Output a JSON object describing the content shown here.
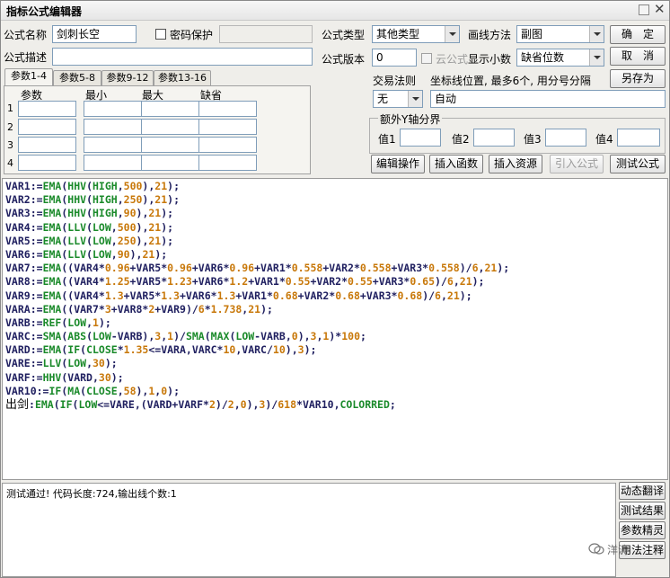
{
  "window": {
    "title": "指标公式编辑器"
  },
  "form": {
    "name_label": "公式名称",
    "name_value": "剑刺长空",
    "password_label": "密码保护",
    "desc_label": "公式描述",
    "type_label": "公式类型",
    "type_value": "其他类型",
    "draw_label": "画线方法",
    "draw_value": "副图",
    "version_label": "公式版本",
    "version_value": "0",
    "cloud_label": "云公式",
    "decimals_label": "显示小数",
    "decimals_value": "缺省位数",
    "trade_label": "交易法则",
    "trade_value": "无",
    "coord_label": "坐标线位置, 最多6个, 用分号分隔",
    "coord_value": "自动",
    "yaxis_label": "额外Y轴分界",
    "val1": "值1",
    "val2": "值2",
    "val3": "值3",
    "val4": "值4"
  },
  "buttons": {
    "ok": "确　定",
    "cancel": "取　消",
    "save_as": "另存为",
    "edit_ops": "编辑操作",
    "insert_fn": "插入函数",
    "insert_res": "插入资源",
    "import_formula": "引入公式",
    "test_formula": "测试公式"
  },
  "tabs": [
    "参数1-4",
    "参数5-8",
    "参数9-12",
    "参数13-16"
  ],
  "params": {
    "headers": [
      "参数",
      "最小",
      "最大",
      "缺省"
    ],
    "rows": [
      "1",
      "2",
      "3",
      "4"
    ]
  },
  "code": [
    [
      [
        "VAR1",
        "id"
      ],
      [
        ":=",
        "op"
      ],
      [
        "EMA",
        "fn"
      ],
      [
        "(",
        "op"
      ],
      [
        "HHV",
        "fn"
      ],
      [
        "(",
        "op"
      ],
      [
        "HIGH",
        "fn"
      ],
      [
        ",",
        "op"
      ],
      [
        "500",
        "num"
      ],
      [
        ")",
        "op"
      ],
      [
        ",",
        "op"
      ],
      [
        "21",
        "num"
      ],
      [
        ");",
        "op"
      ]
    ],
    [
      [
        "VAR2",
        "id"
      ],
      [
        ":=",
        "op"
      ],
      [
        "EMA",
        "fn"
      ],
      [
        "(",
        "op"
      ],
      [
        "HHV",
        "fn"
      ],
      [
        "(",
        "op"
      ],
      [
        "HIGH",
        "fn"
      ],
      [
        ",",
        "op"
      ],
      [
        "250",
        "num"
      ],
      [
        ")",
        "op"
      ],
      [
        ",",
        "op"
      ],
      [
        "21",
        "num"
      ],
      [
        ");",
        "op"
      ]
    ],
    [
      [
        "VAR3",
        "id"
      ],
      [
        ":=",
        "op"
      ],
      [
        "EMA",
        "fn"
      ],
      [
        "(",
        "op"
      ],
      [
        "HHV",
        "fn"
      ],
      [
        "(",
        "op"
      ],
      [
        "HIGH",
        "fn"
      ],
      [
        ",",
        "op"
      ],
      [
        "90",
        "num"
      ],
      [
        ")",
        "op"
      ],
      [
        ",",
        "op"
      ],
      [
        "21",
        "num"
      ],
      [
        ");",
        "op"
      ]
    ],
    [
      [
        "VAR4",
        "id"
      ],
      [
        ":=",
        "op"
      ],
      [
        "EMA",
        "fn"
      ],
      [
        "(",
        "op"
      ],
      [
        "LLV",
        "fn"
      ],
      [
        "(",
        "op"
      ],
      [
        "LOW",
        "fn"
      ],
      [
        ",",
        "op"
      ],
      [
        "500",
        "num"
      ],
      [
        ")",
        "op"
      ],
      [
        ",",
        "op"
      ],
      [
        "21",
        "num"
      ],
      [
        ");",
        "op"
      ]
    ],
    [
      [
        "VAR5",
        "id"
      ],
      [
        ":=",
        "op"
      ],
      [
        "EMA",
        "fn"
      ],
      [
        "(",
        "op"
      ],
      [
        "LLV",
        "fn"
      ],
      [
        "(",
        "op"
      ],
      [
        "LOW",
        "fn"
      ],
      [
        ",",
        "op"
      ],
      [
        "250",
        "num"
      ],
      [
        ")",
        "op"
      ],
      [
        ",",
        "op"
      ],
      [
        "21",
        "num"
      ],
      [
        ");",
        "op"
      ]
    ],
    [
      [
        "VAR6",
        "id"
      ],
      [
        ":=",
        "op"
      ],
      [
        "EMA",
        "fn"
      ],
      [
        "(",
        "op"
      ],
      [
        "LLV",
        "fn"
      ],
      [
        "(",
        "op"
      ],
      [
        "LOW",
        "fn"
      ],
      [
        ",",
        "op"
      ],
      [
        "90",
        "num"
      ],
      [
        ")",
        "op"
      ],
      [
        ",",
        "op"
      ],
      [
        "21",
        "num"
      ],
      [
        ");",
        "op"
      ]
    ],
    [
      [
        "VAR7",
        "id"
      ],
      [
        ":=",
        "op"
      ],
      [
        "EMA",
        "fn"
      ],
      [
        "((",
        "op"
      ],
      [
        "VAR4",
        "id"
      ],
      [
        "*",
        "op"
      ],
      [
        "0.96",
        "num"
      ],
      [
        "+",
        "op"
      ],
      [
        "VAR5",
        "id"
      ],
      [
        "*",
        "op"
      ],
      [
        "0.96",
        "num"
      ],
      [
        "+",
        "op"
      ],
      [
        "VAR6",
        "id"
      ],
      [
        "*",
        "op"
      ],
      [
        "0.96",
        "num"
      ],
      [
        "+",
        "op"
      ],
      [
        "VAR1",
        "id"
      ],
      [
        "*",
        "op"
      ],
      [
        "0.558",
        "num"
      ],
      [
        "+",
        "op"
      ],
      [
        "VAR2",
        "id"
      ],
      [
        "*",
        "op"
      ],
      [
        "0.558",
        "num"
      ],
      [
        "+",
        "op"
      ],
      [
        "VAR3",
        "id"
      ],
      [
        "*",
        "op"
      ],
      [
        "0.558",
        "num"
      ],
      [
        ")/",
        "op"
      ],
      [
        "6",
        "num"
      ],
      [
        ",",
        "op"
      ],
      [
        "21",
        "num"
      ],
      [
        ");",
        "op"
      ]
    ],
    [
      [
        "VAR8",
        "id"
      ],
      [
        ":=",
        "op"
      ],
      [
        "EMA",
        "fn"
      ],
      [
        "((",
        "op"
      ],
      [
        "VAR4",
        "id"
      ],
      [
        "*",
        "op"
      ],
      [
        "1.25",
        "num"
      ],
      [
        "+",
        "op"
      ],
      [
        "VAR5",
        "id"
      ],
      [
        "*",
        "op"
      ],
      [
        "1.23",
        "num"
      ],
      [
        "+",
        "op"
      ],
      [
        "VAR6",
        "id"
      ],
      [
        "*",
        "op"
      ],
      [
        "1.2",
        "num"
      ],
      [
        "+",
        "op"
      ],
      [
        "VAR1",
        "id"
      ],
      [
        "*",
        "op"
      ],
      [
        "0.55",
        "num"
      ],
      [
        "+",
        "op"
      ],
      [
        "VAR2",
        "id"
      ],
      [
        "*",
        "op"
      ],
      [
        "0.55",
        "num"
      ],
      [
        "+",
        "op"
      ],
      [
        "VAR3",
        "id"
      ],
      [
        "*",
        "op"
      ],
      [
        "0.65",
        "num"
      ],
      [
        ")/",
        "op"
      ],
      [
        "6",
        "num"
      ],
      [
        ",",
        "op"
      ],
      [
        "21",
        "num"
      ],
      [
        ");",
        "op"
      ]
    ],
    [
      [
        "VAR9",
        "id"
      ],
      [
        ":=",
        "op"
      ],
      [
        "EMA",
        "fn"
      ],
      [
        "((",
        "op"
      ],
      [
        "VAR4",
        "id"
      ],
      [
        "*",
        "op"
      ],
      [
        "1.3",
        "num"
      ],
      [
        "+",
        "op"
      ],
      [
        "VAR5",
        "id"
      ],
      [
        "*",
        "op"
      ],
      [
        "1.3",
        "num"
      ],
      [
        "+",
        "op"
      ],
      [
        "VAR6",
        "id"
      ],
      [
        "*",
        "op"
      ],
      [
        "1.3",
        "num"
      ],
      [
        "+",
        "op"
      ],
      [
        "VAR1",
        "id"
      ],
      [
        "*",
        "op"
      ],
      [
        "0.68",
        "num"
      ],
      [
        "+",
        "op"
      ],
      [
        "VAR2",
        "id"
      ],
      [
        "*",
        "op"
      ],
      [
        "0.68",
        "num"
      ],
      [
        "+",
        "op"
      ],
      [
        "VAR3",
        "id"
      ],
      [
        "*",
        "op"
      ],
      [
        "0.68",
        "num"
      ],
      [
        ")/",
        "op"
      ],
      [
        "6",
        "num"
      ],
      [
        ",",
        "op"
      ],
      [
        "21",
        "num"
      ],
      [
        ");",
        "op"
      ]
    ],
    [
      [
        "VARA",
        "id"
      ],
      [
        ":=",
        "op"
      ],
      [
        "EMA",
        "fn"
      ],
      [
        "((",
        "op"
      ],
      [
        "VAR7",
        "id"
      ],
      [
        "*",
        "op"
      ],
      [
        "3",
        "num"
      ],
      [
        "+",
        "op"
      ],
      [
        "VAR8",
        "id"
      ],
      [
        "*",
        "op"
      ],
      [
        "2",
        "num"
      ],
      [
        "+",
        "op"
      ],
      [
        "VAR9",
        "id"
      ],
      [
        ")/",
        "op"
      ],
      [
        "6",
        "num"
      ],
      [
        "*",
        "op"
      ],
      [
        "1.738",
        "num"
      ],
      [
        ",",
        "op"
      ],
      [
        "21",
        "num"
      ],
      [
        ");",
        "op"
      ]
    ],
    [
      [
        "VARB",
        "id"
      ],
      [
        ":=",
        "op"
      ],
      [
        "REF",
        "fn"
      ],
      [
        "(",
        "op"
      ],
      [
        "LOW",
        "fn"
      ],
      [
        ",",
        "op"
      ],
      [
        "1",
        "num"
      ],
      [
        ");",
        "op"
      ]
    ],
    [
      [
        "VARC",
        "id"
      ],
      [
        ":=",
        "op"
      ],
      [
        "SMA",
        "fn"
      ],
      [
        "(",
        "op"
      ],
      [
        "ABS",
        "fn"
      ],
      [
        "(",
        "op"
      ],
      [
        "LOW",
        "fn"
      ],
      [
        "-",
        "op"
      ],
      [
        "VARB",
        "id"
      ],
      [
        "),",
        "op"
      ],
      [
        "3",
        "num"
      ],
      [
        ",",
        "op"
      ],
      [
        "1",
        "num"
      ],
      [
        ")/",
        "op"
      ],
      [
        "SMA",
        "fn"
      ],
      [
        "(",
        "op"
      ],
      [
        "MAX",
        "fn"
      ],
      [
        "(",
        "op"
      ],
      [
        "LOW",
        "fn"
      ],
      [
        "-",
        "op"
      ],
      [
        "VARB",
        "id"
      ],
      [
        ",",
        "op"
      ],
      [
        "0",
        "num"
      ],
      [
        "),",
        "op"
      ],
      [
        "3",
        "num"
      ],
      [
        ",",
        "op"
      ],
      [
        "1",
        "num"
      ],
      [
        ")*",
        "op"
      ],
      [
        "100",
        "num"
      ],
      [
        ";",
        "op"
      ]
    ],
    [
      [
        "VARD",
        "id"
      ],
      [
        ":=",
        "op"
      ],
      [
        "EMA",
        "fn"
      ],
      [
        "(",
        "op"
      ],
      [
        "IF",
        "fn"
      ],
      [
        "(",
        "op"
      ],
      [
        "CLOSE",
        "fn"
      ],
      [
        "*",
        "op"
      ],
      [
        "1.35",
        "num"
      ],
      [
        "<=",
        "op"
      ],
      [
        "VARA",
        "id"
      ],
      [
        ",",
        "op"
      ],
      [
        "VARC",
        "id"
      ],
      [
        "*",
        "op"
      ],
      [
        "10",
        "num"
      ],
      [
        ",",
        "op"
      ],
      [
        "VARC",
        "id"
      ],
      [
        "/",
        "op"
      ],
      [
        "10",
        "num"
      ],
      [
        "),",
        "op"
      ],
      [
        "3",
        "num"
      ],
      [
        ");",
        "op"
      ]
    ],
    [
      [
        "VARE",
        "id"
      ],
      [
        ":=",
        "op"
      ],
      [
        "LLV",
        "fn"
      ],
      [
        "(",
        "op"
      ],
      [
        "LOW",
        "fn"
      ],
      [
        ",",
        "op"
      ],
      [
        "30",
        "num"
      ],
      [
        ");",
        "op"
      ]
    ],
    [
      [
        "VARF",
        "id"
      ],
      [
        ":=",
        "op"
      ],
      [
        "HHV",
        "fn"
      ],
      [
        "(",
        "op"
      ],
      [
        "VARD",
        "id"
      ],
      [
        ",",
        "op"
      ],
      [
        "30",
        "num"
      ],
      [
        ");",
        "op"
      ]
    ],
    [
      [
        "VAR10",
        "id"
      ],
      [
        ":=",
        "op"
      ],
      [
        "IF",
        "fn"
      ],
      [
        "(",
        "op"
      ],
      [
        "MA",
        "fn"
      ],
      [
        "(",
        "op"
      ],
      [
        "CLOSE",
        "fn"
      ],
      [
        ",",
        "op"
      ],
      [
        "58",
        "num"
      ],
      [
        "),",
        "op"
      ],
      [
        "1",
        "num"
      ],
      [
        ",",
        "op"
      ],
      [
        "0",
        "num"
      ],
      [
        ");",
        "op"
      ]
    ],
    [
      [
        "出剑",
        "cn"
      ],
      [
        ":",
        "op"
      ],
      [
        "EMA",
        "fn"
      ],
      [
        "(",
        "op"
      ],
      [
        "IF",
        "fn"
      ],
      [
        "(",
        "op"
      ],
      [
        "LOW",
        "fn"
      ],
      [
        "<=",
        "op"
      ],
      [
        "VARE",
        "id"
      ],
      [
        ",(",
        "op"
      ],
      [
        "VARD",
        "id"
      ],
      [
        "+",
        "op"
      ],
      [
        "VARF",
        "id"
      ],
      [
        "*",
        "op"
      ],
      [
        "2",
        "num"
      ],
      [
        ")/",
        "op"
      ],
      [
        "2",
        "num"
      ],
      [
        ",",
        "op"
      ],
      [
        "0",
        "num"
      ],
      [
        "),",
        "op"
      ],
      [
        "3",
        "num"
      ],
      [
        ")/",
        "op"
      ],
      [
        "618",
        "num"
      ],
      [
        "*",
        "op"
      ],
      [
        "VAR10",
        "id"
      ],
      [
        ",",
        "op"
      ],
      [
        "COLORRED",
        "col"
      ],
      [
        ";",
        "op"
      ]
    ]
  ],
  "output": {
    "text": "测试通过! 代码长度:724,输出线个数:1"
  },
  "side_buttons": [
    "动态翻译",
    "测试结果",
    "参数精灵",
    "用法注释"
  ],
  "watermark": "洋涛"
}
